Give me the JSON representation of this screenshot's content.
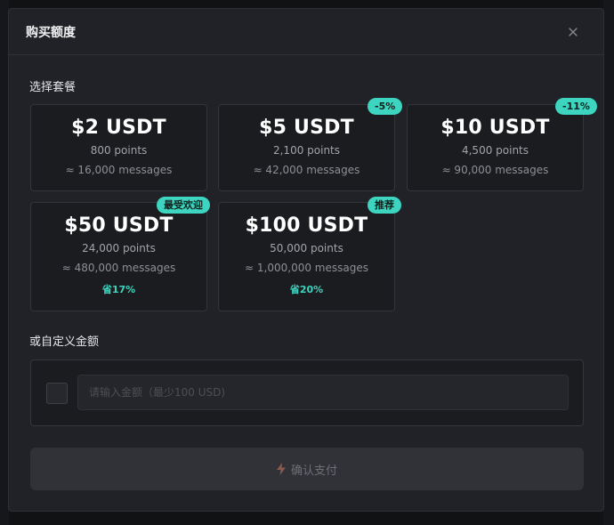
{
  "modal": {
    "title": "购买额度",
    "close_icon": "close-icon"
  },
  "packages_section": {
    "label": "选择套餐"
  },
  "packages": [
    {
      "price": "$2 USDT",
      "points": "800 points",
      "messages": "≈ 16,000 messages",
      "badge": "",
      "savings": ""
    },
    {
      "price": "$5 USDT",
      "points": "2,100 points",
      "messages": "≈ 42,000 messages",
      "badge": "-5%",
      "savings": ""
    },
    {
      "price": "$10 USDT",
      "points": "4,500 points",
      "messages": "≈ 90,000 messages",
      "badge": "-11%",
      "savings": ""
    },
    {
      "price": "$50 USDT",
      "points": "24,000 points",
      "messages": "≈ 480,000 messages",
      "badge": "最受欢迎",
      "savings": "省17%"
    },
    {
      "price": "$100 USDT",
      "points": "50,000 points",
      "messages": "≈ 1,000,000 messages",
      "badge": "推荐",
      "savings": "省20%"
    }
  ],
  "custom": {
    "label": "或自定义金额",
    "placeholder": "请输入金额（最少100 USD)",
    "value": ""
  },
  "pay_button": {
    "label": "确认支付",
    "icon": "lightning-icon"
  },
  "colors": {
    "accent": "#3dd5bf",
    "modal_bg": "#202227",
    "card_bg": "#1b1c20",
    "button_disabled": "#313238"
  }
}
